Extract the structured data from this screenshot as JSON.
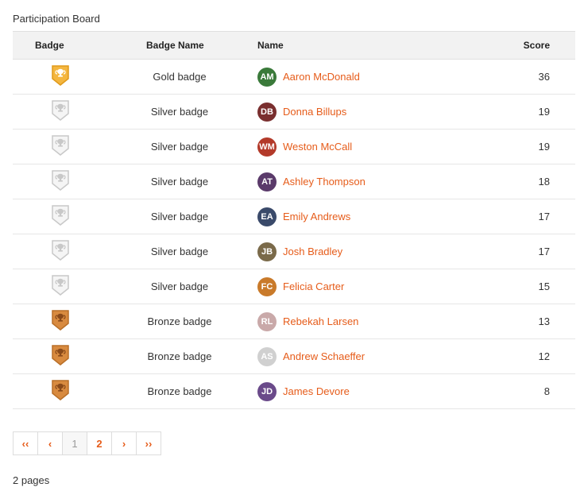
{
  "title": "Participation Board",
  "columns": {
    "badge": "Badge",
    "badge_name": "Badge Name",
    "name": "Name",
    "score": "Score"
  },
  "badges": {
    "gold": {
      "label": "Gold badge",
      "fill": "#f4b63f",
      "stroke": "#e09a1a",
      "cup": "#ffffff"
    },
    "silver": {
      "label": "Silver badge",
      "fill": "#f5f5f5",
      "stroke": "#c8c8c8",
      "cup": "#c8c8c8"
    },
    "bronze": {
      "label": "Bronze badge",
      "fill": "#d88a3f",
      "stroke": "#b96f28",
      "cup": "#8a4a1a"
    }
  },
  "rows": [
    {
      "badge": "gold",
      "name": "Aaron McDonald",
      "score": 36,
      "avatar_bg": "#3a7a3a"
    },
    {
      "badge": "silver",
      "name": "Donna Billups",
      "score": 19,
      "avatar_bg": "#7a2f2f"
    },
    {
      "badge": "silver",
      "name": "Weston McCall",
      "score": 19,
      "avatar_bg": "#b33a2a"
    },
    {
      "badge": "silver",
      "name": "Ashley Thompson",
      "score": 18,
      "avatar_bg": "#5a3a6a"
    },
    {
      "badge": "silver",
      "name": "Emily Andrews",
      "score": 17,
      "avatar_bg": "#3a4a6a"
    },
    {
      "badge": "silver",
      "name": "Josh Bradley",
      "score": 17,
      "avatar_bg": "#7a6a4a"
    },
    {
      "badge": "silver",
      "name": "Felicia Carter",
      "score": 15,
      "avatar_bg": "#c97a2a"
    },
    {
      "badge": "bronze",
      "name": "Rebekah Larsen",
      "score": 13,
      "avatar_bg": "#c9a9a9"
    },
    {
      "badge": "bronze",
      "name": "Andrew Schaeffer",
      "score": 12,
      "avatar_bg": "#d0d0d0"
    },
    {
      "badge": "bronze",
      "name": "James Devore",
      "score": 8,
      "avatar_bg": "#6a4a8a"
    }
  ],
  "pagination": {
    "first": "‹‹",
    "prev": "‹",
    "pages": [
      "1",
      "2"
    ],
    "current_index": 0,
    "next": "›",
    "last": "››",
    "summary": "2 pages"
  }
}
